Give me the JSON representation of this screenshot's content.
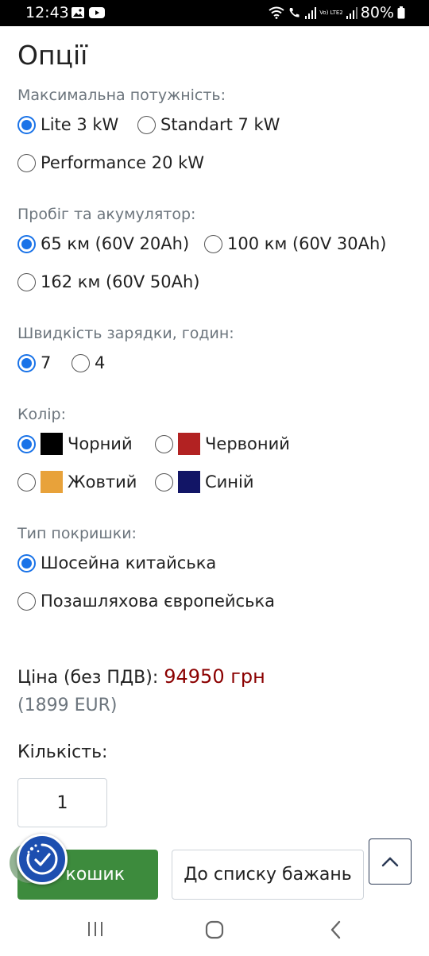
{
  "status_bar": {
    "time": "12:43",
    "battery": "80%",
    "network_badge": "Vo) LTE2"
  },
  "page": {
    "title": "Опції"
  },
  "groups": [
    {
      "label": "Максимальна потужність:",
      "options": [
        "Lite 3 kW",
        "Standart 7 kW",
        "Performance 20 kW"
      ],
      "selected": "Lite 3 kW"
    },
    {
      "label": "Пробіг та акумулятор:",
      "options": [
        "65 км (60V 20Ah)",
        "100 км (60V 30Ah)",
        "162 км (60V 50Ah)"
      ],
      "selected": "65 км (60V 20Ah)"
    },
    {
      "label": "Швидкість зарядки, годин:",
      "options": [
        "7",
        "4"
      ],
      "selected": "7"
    },
    {
      "label": "Колір:",
      "options": [
        "Чорний",
        "Червоний",
        "Жовтий",
        "Синій"
      ],
      "swatches": [
        "#000000",
        "#b22222",
        "#e8a23a",
        "#121566"
      ],
      "selected": "Чорний"
    },
    {
      "label": "Тип покришки:",
      "options": [
        "Шосейна китайська",
        "Позашляхова європейська"
      ],
      "selected": "Шосейна китайська"
    }
  ],
  "price": {
    "label": "Ціна (без ПДВ):",
    "value": "94950 грн",
    "eur": "(1899 EUR)"
  },
  "quantity": {
    "label": "Кількість:",
    "value": "1"
  },
  "buttons": {
    "cart": "кошик",
    "wishlist": "До списку бажань"
  },
  "colors": {
    "accent": "#1a73e8",
    "price": "#8b0000",
    "cart_button": "#3d8b3d",
    "accessibility": "#1d4fb0"
  }
}
